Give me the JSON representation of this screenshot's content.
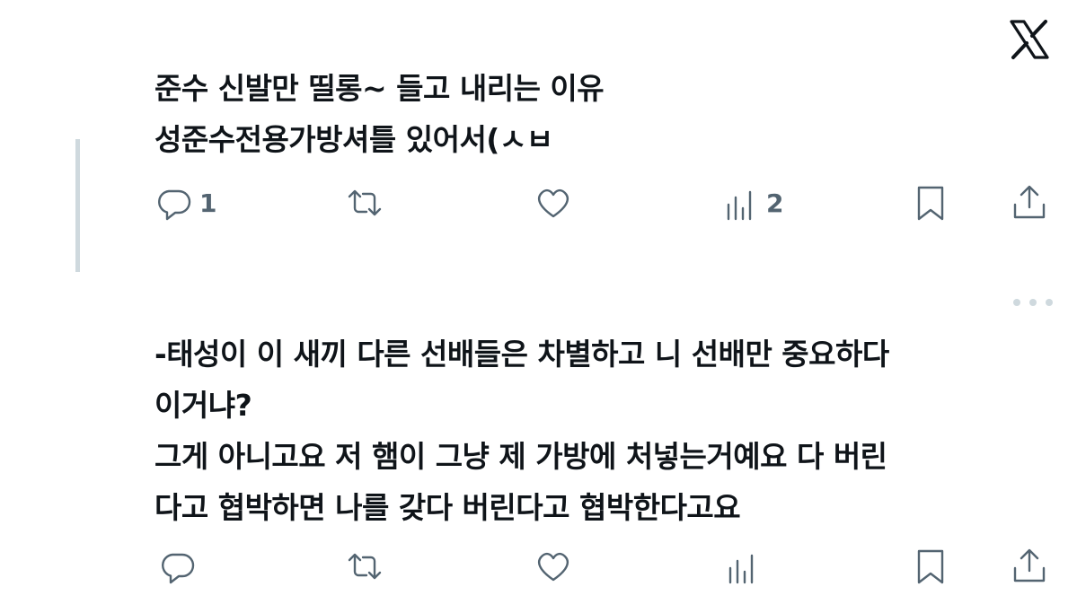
{
  "brand": {
    "logo_icon": "x-logo-icon"
  },
  "tweets": [
    {
      "text": "준수 신발만 띨롱~ 들고 내리는 이유\n성준수전용가방셔틀 있어서(ㅅㅂ",
      "actions": {
        "reply_count": "1",
        "retweet_count": "",
        "like_count": "",
        "view_count": "2"
      }
    },
    {
      "text": "-태성이 이 새끼 다른 선배들은 차별하고 니 선배만 중요하다\n이거냐?\n그게 아니고요 저 햄이 그냥 제 가방에 처넣는거예요 다 버린\n다고 협박하면 나를 갖다 버린다고 협박한다고요",
      "actions": {
        "reply_count": "",
        "retweet_count": "",
        "like_count": "",
        "view_count": ""
      }
    }
  ],
  "colors": {
    "text": "#0f1419",
    "icon": "#536471",
    "thread_line": "#cfd9de"
  }
}
